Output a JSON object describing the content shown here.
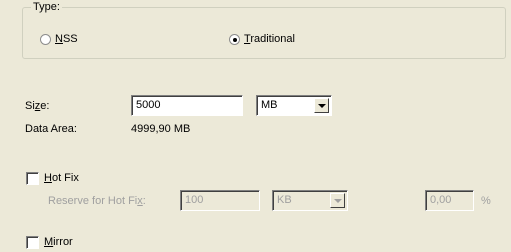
{
  "type_group": {
    "legend": "Type:",
    "options": [
      {
        "label": "NSS",
        "selected": false
      },
      {
        "label": "Traditional",
        "selected": true
      }
    ]
  },
  "size": {
    "label": "Size:",
    "value": "5000",
    "unit": "MB"
  },
  "data_area": {
    "label": "Data Area:",
    "value": "4999,90 MB"
  },
  "hot_fix": {
    "label": "Hot Fix",
    "checked": false,
    "reserve_label": "Reserve for Hot Fix:",
    "reserve_value": "100",
    "reserve_unit": "KB",
    "percent_value": "0,00",
    "percent_symbol": "%"
  },
  "mirror": {
    "label": "Mirror",
    "checked": false
  }
}
